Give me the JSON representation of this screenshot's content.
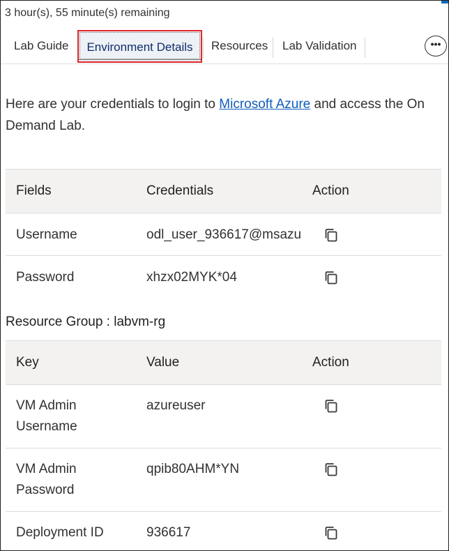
{
  "timer": {
    "text": "3 hour(s), 55 minute(s) remaining"
  },
  "tabs": [
    {
      "label": "Lab Guide",
      "selected": false
    },
    {
      "label": "Environment Details",
      "selected": true
    },
    {
      "label": "Resources",
      "selected": false
    },
    {
      "label": "Lab Validation",
      "selected": false
    }
  ],
  "more_button": {
    "icon": "more-horizontal-icon",
    "glyph": "•••"
  },
  "intro": {
    "before_link": "Here are your credentials to login to ",
    "link_text": "Microsoft Azure",
    "after_link": " and access the On Demand Lab."
  },
  "credentials_table": {
    "headers": [
      "Fields",
      "Credentials",
      "Action"
    ],
    "rows": [
      {
        "field": "Username",
        "value": "odl_user_936617@msazu",
        "action_icon": "copy-icon"
      },
      {
        "field": "Password",
        "value": "xhzx02MYK*04",
        "action_icon": "copy-icon"
      }
    ]
  },
  "resource_group": {
    "label": "Resource Group : labvm-rg",
    "headers": [
      "Key",
      "Value",
      "Action"
    ],
    "rows": [
      {
        "key": "VM Admin Username",
        "value": "azureuser",
        "action_icon": "copy-icon"
      },
      {
        "key": "VM Admin Password",
        "value": "qpib80AHM*YN",
        "action_icon": "copy-icon"
      },
      {
        "key": "Deployment ID",
        "value": "936617",
        "action_icon": "copy-icon"
      }
    ]
  },
  "colors": {
    "link": "#0f5cbe",
    "selected_tab_border": "#e1272a",
    "header_bg": "#f3f2f1"
  }
}
